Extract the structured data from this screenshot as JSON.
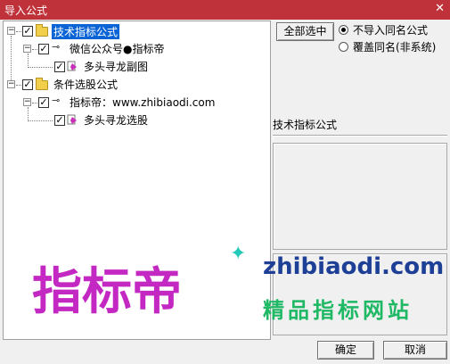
{
  "window": {
    "title": "导入公式",
    "close_glyph": "✕"
  },
  "tree": {
    "groups": [
      {
        "label": "技术指标公式",
        "checked": true,
        "selected": true,
        "children": [
          {
            "label": "微信公众号●指标帝",
            "checked": true,
            "children": [
              {
                "label": "多头寻龙副图",
                "checked": true
              }
            ]
          }
        ]
      },
      {
        "label": "条件选股公式",
        "checked": true,
        "selected": false,
        "children": [
          {
            "label": "指标帝：www.zhibiaodi.com",
            "checked": true,
            "children": [
              {
                "label": "多头寻龙选股",
                "checked": true
              }
            ]
          }
        ]
      }
    ]
  },
  "right": {
    "select_all_label": "全部选中",
    "options": [
      {
        "label": "不导入同名公式",
        "selected": true
      },
      {
        "label": "覆盖同名(非系统)",
        "selected": false
      }
    ],
    "info_label": "技术指标公式"
  },
  "watermark": {
    "logo_text": "指标帝",
    "domain": "zhibiaodi.com",
    "slogan": "精品指标网站"
  },
  "buttons": {
    "ok_label": "确定",
    "cancel_label": "取消"
  },
  "colors": {
    "titlebar": "#c0323a",
    "selection": "#0a64d6",
    "logo": "#c428c2",
    "slogan": "#1fb865",
    "domain": "#1d3f96"
  }
}
